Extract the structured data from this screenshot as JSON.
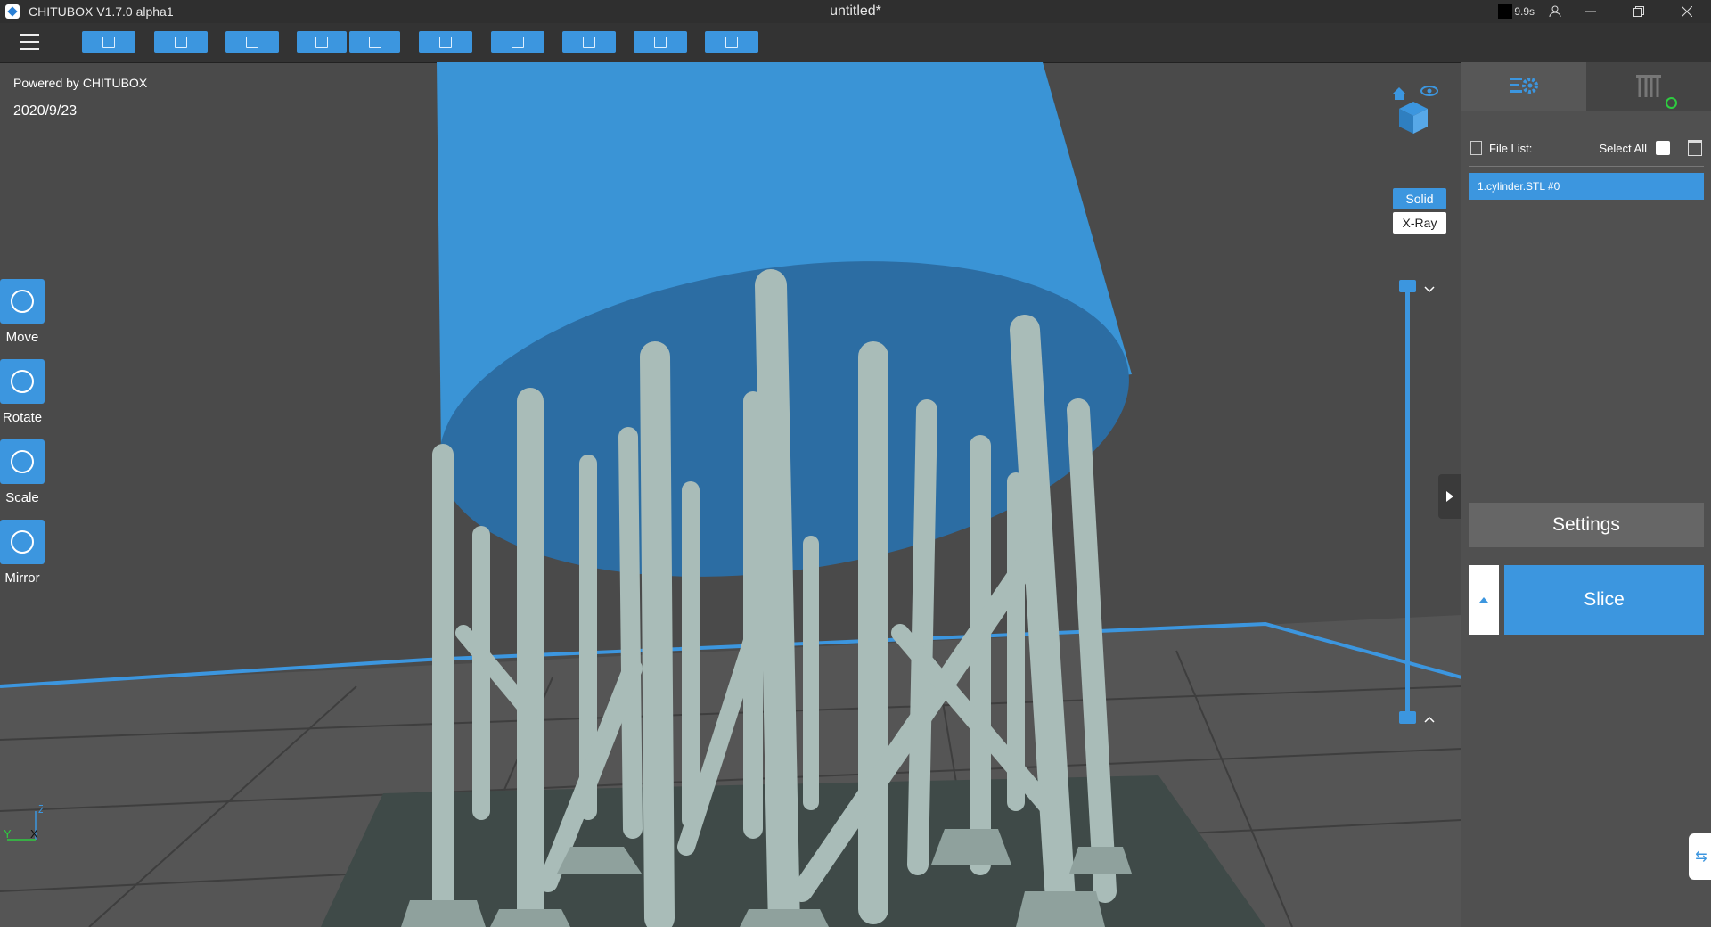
{
  "titlebar": {
    "app_name": "CHITUBOX V1.7.0 alpha1",
    "document_title": "untitled*",
    "clock_text": "9.9s"
  },
  "toolbar": {
    "buttons": [
      {
        "name": "open-file-icon"
      },
      {
        "name": "save-icon"
      },
      {
        "name": "import-icon"
      },
      {
        "name": "undo-icon"
      },
      {
        "name": "redo-icon"
      },
      {
        "name": "copy-icon"
      },
      {
        "name": "arrange-icon"
      },
      {
        "name": "support-icon"
      },
      {
        "name": "hollow-icon"
      },
      {
        "name": "print-settings-icon"
      }
    ]
  },
  "viewport": {
    "powered_by": "Powered by CHITUBOX",
    "date": "2020/9/23",
    "view_modes": {
      "solid": "Solid",
      "xray": "X-Ray"
    },
    "tools": [
      {
        "name": "move",
        "label": "Move"
      },
      {
        "name": "rotate",
        "label": "Rotate"
      },
      {
        "name": "scale",
        "label": "Scale"
      },
      {
        "name": "mirror",
        "label": "Mirror"
      }
    ],
    "axis": {
      "z": "Z",
      "y": "Y",
      "x": "X"
    }
  },
  "side_panel": {
    "file_list_label": "File List:",
    "select_all_label": "Select All",
    "files": [
      "1.cylinder.STL #0"
    ],
    "settings_label": "Settings",
    "slice_label": "Slice"
  },
  "colors": {
    "accent": "#3c96df",
    "model": "#3a94d6",
    "supports": "#a9bcb8",
    "floor": "#555555",
    "panel": "#505050"
  }
}
